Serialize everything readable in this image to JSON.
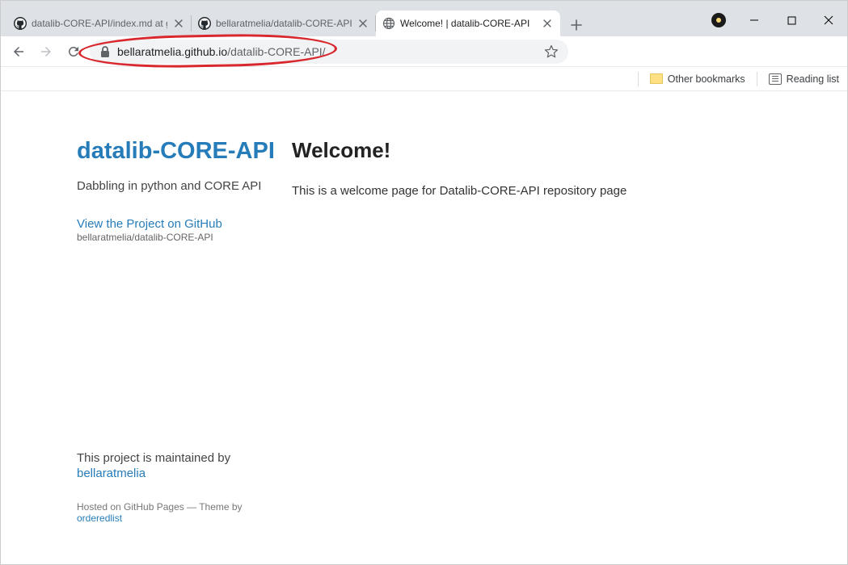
{
  "tabs": [
    {
      "title": "datalib-CORE-API/index.md at gh",
      "favicon": "github"
    },
    {
      "title": "bellaratmelia/datalib-CORE-API a",
      "favicon": "github"
    },
    {
      "title": "Welcome! | datalib-CORE-API",
      "favicon": "globe",
      "active": true
    }
  ],
  "url": {
    "host": "bellaratmelia.github.io",
    "path": "/datalib-CORE-API/"
  },
  "bookmarks": {
    "other": "Other bookmarks",
    "reading": "Reading list"
  },
  "site": {
    "title": "datalib-CORE-API",
    "description": "Dabbling in python and CORE API",
    "github_link": "View the Project on GitHub",
    "github_repo": "bellaratmelia/datalib-CORE-API",
    "maintained_prefix": "This project is maintained by",
    "maintainer": "bellaratmelia",
    "hosted_prefix": "Hosted on GitHub Pages — Theme by ",
    "theme": "orderedlist"
  },
  "content": {
    "heading": "Welcome!",
    "paragraph": "This is a welcome page for Datalib-CORE-API repository page"
  }
}
